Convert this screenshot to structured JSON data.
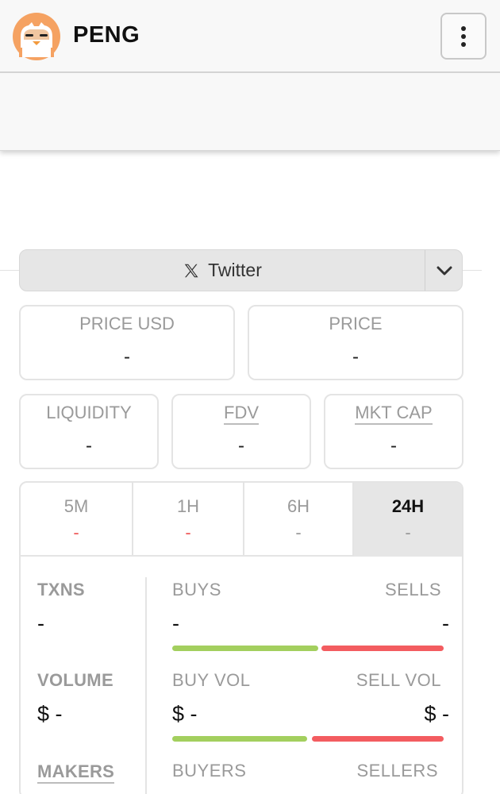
{
  "header": {
    "token_name": "PENG",
    "menu_icon": "more-vertical-icon"
  },
  "social": {
    "label": "Twitter",
    "icon": "x-logo-icon",
    "dropdown_icon": "chevron-down-icon"
  },
  "stats_row1": [
    {
      "label": "PRICE USD",
      "value": "-"
    },
    {
      "label": "PRICE",
      "value": "-"
    }
  ],
  "stats_row2": [
    {
      "label": "LIQUIDITY",
      "value": "-"
    },
    {
      "label": "FDV",
      "value": "-"
    },
    {
      "label": "MKT CAP",
      "value": "-"
    }
  ],
  "tabs": [
    {
      "label": "5M",
      "value": "-",
      "value_color": "#ee5a5a"
    },
    {
      "label": "1H",
      "value": "-",
      "value_color": "#ee5a5a"
    },
    {
      "label": "6H",
      "value": "-",
      "value_color": "#9a9a9a"
    },
    {
      "label": "24H",
      "value": "-",
      "value_color": "#9a9a9a",
      "active": true
    }
  ],
  "metrics": {
    "txns": {
      "label": "TXNS",
      "value": "-"
    },
    "volume": {
      "label": "VOLUME",
      "value": "$ -"
    },
    "makers": {
      "label": "MAKERS"
    }
  },
  "breakdown": {
    "buys": {
      "label": "BUYS",
      "value": "-"
    },
    "sells": {
      "label": "SELLS",
      "value": "-"
    },
    "buy_vol": {
      "label": "BUY VOL",
      "value": "$ -"
    },
    "sell_vol": {
      "label": "SELL VOL",
      "value": "$ -"
    },
    "buyers": {
      "label": "BUYERS"
    },
    "sellers": {
      "label": "SELLERS"
    }
  },
  "colors": {
    "buy": "#a3cf5e",
    "sell": "#f35c60",
    "negative_change": "#ee5a5a"
  }
}
